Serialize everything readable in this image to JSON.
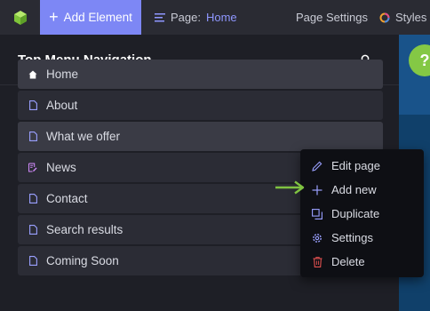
{
  "toolbar": {
    "add_element_label": "Add Element",
    "page_label": "Page:",
    "page_value": "Home",
    "page_settings_label": "Page Settings",
    "styles_label": "Styles"
  },
  "panel": {
    "title": "Top Menu Navigation",
    "items": [
      {
        "label": "Home",
        "icon": "home-icon"
      },
      {
        "label": "About",
        "icon": "page-icon"
      },
      {
        "label": "What we offer",
        "icon": "page-icon"
      },
      {
        "label": "News",
        "icon": "blog-icon"
      },
      {
        "label": "Contact",
        "icon": "page-icon"
      },
      {
        "label": "Search results",
        "icon": "page-icon"
      },
      {
        "label": "Coming Soon",
        "icon": "page-icon"
      }
    ]
  },
  "context_menu": {
    "items": [
      {
        "label": "Edit page",
        "icon": "pencil-icon"
      },
      {
        "label": "Add new",
        "icon": "plus-icon"
      },
      {
        "label": "Duplicate",
        "icon": "duplicate-icon"
      },
      {
        "label": "Settings",
        "icon": "gear-icon"
      },
      {
        "label": "Delete",
        "icon": "trash-icon"
      }
    ]
  },
  "help": {
    "label": "?"
  },
  "colors": {
    "accent": "#7d87f5",
    "page_value": "#8f97ff",
    "help_green": "#84c845",
    "arrow_green": "#7fc241",
    "delete_red": "#e0504f"
  }
}
